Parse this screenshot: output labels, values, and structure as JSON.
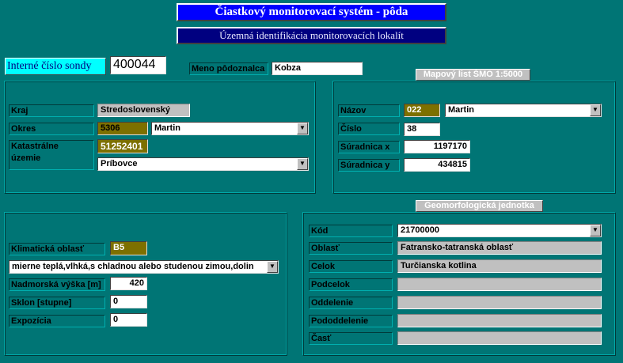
{
  "header": {
    "title": "Čiastkový monitorovací systém  - pôda",
    "subtitle": "Územná identifikácia monitorovacích lokalít"
  },
  "probe": {
    "label": "Interné číslo sondy",
    "value": "400044",
    "soil_name_label": "Meno pôdoznalca",
    "soil_name_value": "Kobza"
  },
  "admin": {
    "kraj_label": "Kraj",
    "kraj_value": "Stredoslovenský",
    "okres_label": "Okres",
    "okres_code": "5306",
    "okres_value": "Martin",
    "kataster_label_line1": "Katastrálne",
    "kataster_label_line2": "územie",
    "kataster_code": "51252401",
    "kataster_value": "Príbovce"
  },
  "map_sheet": {
    "title": "Mapový list ŠMO 1:5000",
    "nazov_label": "Názov",
    "nazov_code": "022",
    "nazov_value": "Martin",
    "cislo_label": "Číslo",
    "cislo_value": "38",
    "x_label": "Súradnica  x",
    "x_value": "1197170",
    "y_label": "Súradnica  y",
    "y_value": "434815"
  },
  "climate": {
    "area_label": "Klimatická oblasť",
    "area_code": "B5",
    "area_desc": "mierne teplá,vlhká,s chladnou alebo studenou zimou,dolin",
    "altitude_label": "Nadmorská výška [m]",
    "altitude_value": "420",
    "slope_label": "Sklon   [stupne]",
    "slope_value": "0",
    "exposure_label": "Expozícia",
    "exposure_value": "0"
  },
  "geomorph": {
    "title": "Geomorfologická jednotka",
    "kod_label": "Kód",
    "kod_value": "21700000",
    "oblast_label": "Oblasť",
    "oblast_value": "Fatransko-tatranská oblasť",
    "celok_label": "Celok",
    "celok_value": "Turčianska kotlina",
    "podcelok_label": "Podcelok",
    "podcelok_value": "",
    "oddelenie_label": "Oddelenie",
    "oddelenie_value": "",
    "pododdelenie_label": "Pododdelenie",
    "pododdelenie_value": "",
    "cast_label": "Časť",
    "cast_value": ""
  },
  "icons": {
    "dropdown": "chevron-down-icon"
  },
  "colors": {
    "background": "#007575",
    "title_bar": "#0000ff",
    "subtitle_bar": "#000080",
    "code_field": "#7d7000",
    "probe_label": "#00ffff"
  }
}
